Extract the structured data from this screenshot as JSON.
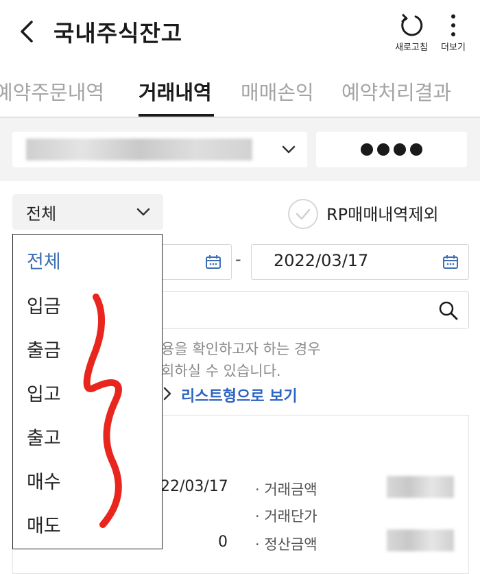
{
  "header": {
    "title": "국내주식잔고",
    "refresh_label": "새로고침",
    "more_label": "더보기"
  },
  "tabs": [
    {
      "label": "예약주문내역",
      "active": false
    },
    {
      "label": "거래내역",
      "active": true
    },
    {
      "label": "매매손익",
      "active": false
    },
    {
      "label": "예약처리결과",
      "active": false
    }
  ],
  "filters": {
    "type_selected": "전체",
    "rp_exclude_label": "RP매매내역제외"
  },
  "dates": {
    "to": "2022/03/17"
  },
  "notice": {
    "line1": "용을 확인하고자 하는 경우",
    "line2": "회하실 수 있습니다.",
    "list_link": "리스트형으로 보기"
  },
  "result": {
    "date": "22/03/17",
    "quantity": "0",
    "labels": {
      "amount": "· 거래금액",
      "unit_price": "· 거래단가",
      "settlement": "· 정산금액"
    }
  },
  "dropdown": {
    "options": [
      "전체",
      "입금",
      "출금",
      "입고",
      "출고",
      "매수",
      "매도"
    ],
    "selected": "전체"
  },
  "colors": {
    "accent": "#3d6eb5",
    "link": "#2c64c2",
    "annotation": "#e8261e"
  }
}
